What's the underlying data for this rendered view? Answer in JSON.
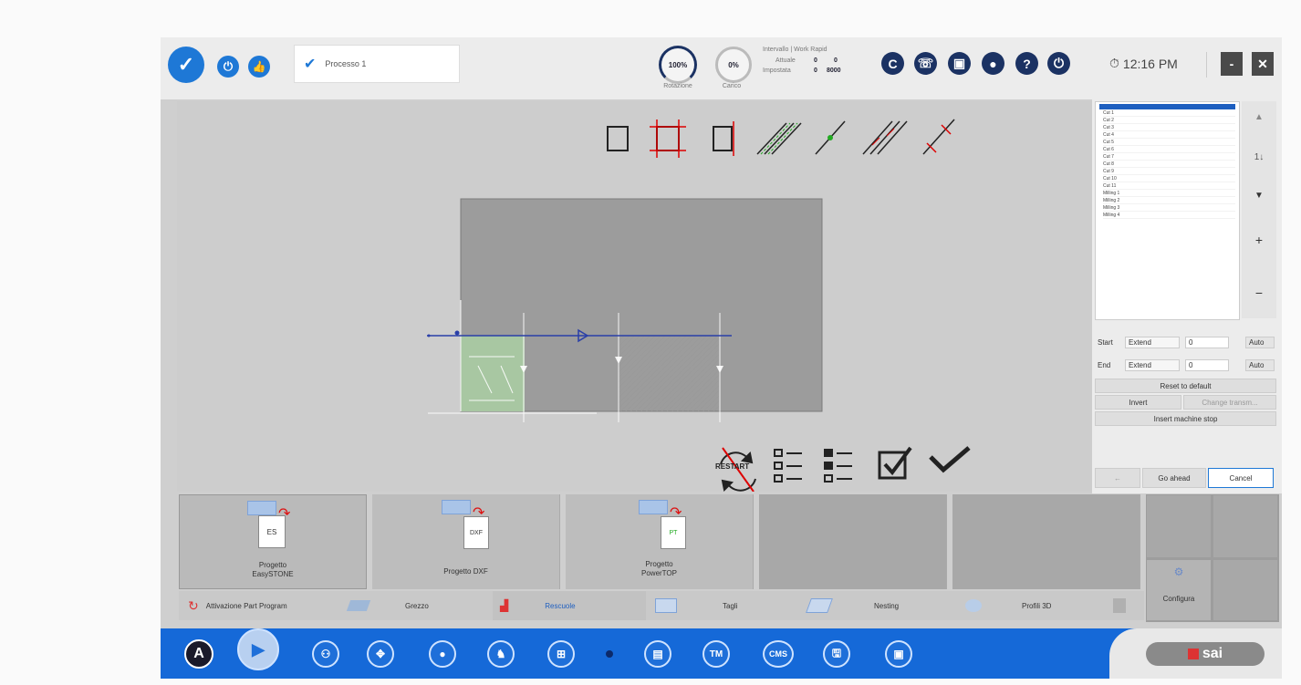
{
  "topbar": {
    "process_tab_label": "Processo 1",
    "gauge_rotation_value": "100%",
    "gauge_rotation_label": "Rotazione",
    "gauge_load_value": "0%",
    "gauge_load_label": "Carico",
    "speed_header": "Intervallo | Work Rapid",
    "actual_label": "Attuale",
    "actual_work": "0",
    "actual_rapid": "0",
    "set_label": "Impostata",
    "set_work": "0",
    "set_rapid": "8000",
    "clock_time": "12:16 PM",
    "minimize_label": "-",
    "close_label": "✕"
  },
  "right_panel": {
    "tree_items": [
      "Cut 1",
      "Cut 2",
      "Cut 3",
      "Cut 4",
      "Cut 5",
      "Cut 6",
      "Cut 7",
      "Cut 8",
      "Cut 9",
      "Cut 10",
      "Cut 11",
      "Milling 1",
      "Milling 2",
      "Milling 3",
      "Milling 4"
    ],
    "start_label": "Start",
    "start_mode": "Extend",
    "start_value": "0",
    "end_label": "End",
    "end_mode": "Extend",
    "end_value": "0",
    "auto_label": "Auto",
    "reset_label": "Reset to default",
    "invert_label": "Invert",
    "change_direction_label": "Change transm...",
    "insert_stop_label": "Insert machine stop",
    "back_label": "←",
    "go_ahead_label": "Go ahead",
    "cancel_label": "Cancel",
    "scroll_up": "▲",
    "scroll_mid": "1↓",
    "scroll_down": "▼",
    "zoom_in": "+",
    "zoom_out": "−"
  },
  "bottom_tiles": [
    {
      "label_line1": "Progetto",
      "label_line2": "EasySTONE",
      "badge": "ES"
    },
    {
      "label_line1": "Progetto DXF",
      "label_line2": "",
      "badge": "DXF"
    },
    {
      "label_line1": "Progetto",
      "label_line2": "PowerTOP",
      "badge": "PT"
    }
  ],
  "side_tiles": {
    "configure_label": "Configura"
  },
  "bottom_tabs": [
    "Attivazione Part Program",
    "Grezzo",
    "Rescuole",
    "Tagli",
    "Nesting",
    "Profili 3D"
  ],
  "restart_label": "RESTART",
  "taskbar": {
    "start_label": "A",
    "tm_label": "TM",
    "cms_label": "CMS",
    "brand": "sai"
  }
}
